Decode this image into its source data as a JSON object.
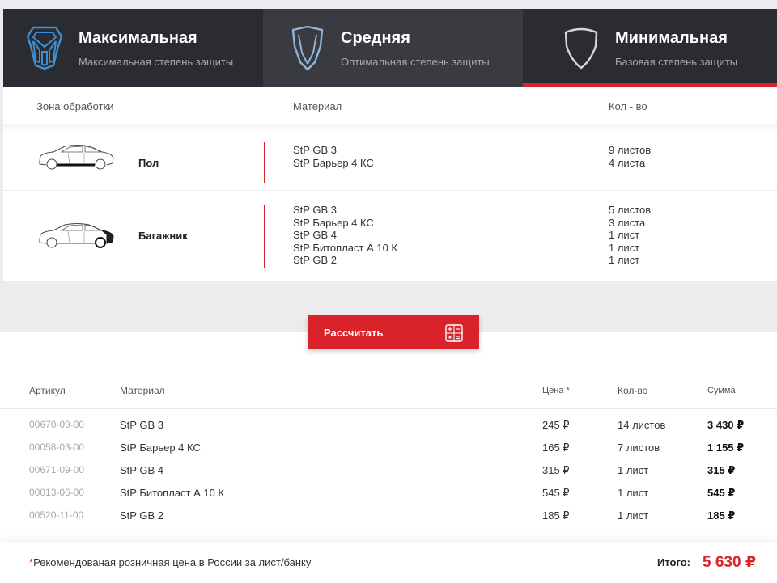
{
  "tabs": [
    {
      "title": "Максимальная",
      "subtitle": "Максимальная степень защиты"
    },
    {
      "title": "Средняя",
      "subtitle": "Оптимальная степень защиты"
    },
    {
      "title": "Минимальная",
      "subtitle": "Базовая степень защиты"
    }
  ],
  "colors": {
    "accent": "#d9222a",
    "tab_bg": "#2b2c31",
    "tab_active_bg": "#3a3b41",
    "icon_blue": "#3a8fd6"
  },
  "zone_table": {
    "headers": {
      "zone": "Зона обработки",
      "material": "Материал",
      "qty": "Кол - во"
    },
    "rows": [
      {
        "zone": "Пол",
        "materials": [
          "StP GB 3",
          "StP Барьер 4 КС"
        ],
        "quantities": [
          "9 листов",
          "4 листа"
        ]
      },
      {
        "zone": "Багажник",
        "materials": [
          "StP GB 3",
          "StP Барьер 4 КС",
          "StP GB 4",
          "StP Битопласт А 10 К",
          "StP GB 2"
        ],
        "quantities": [
          "5 листов",
          "3 листа",
          "1 лист",
          "1 лист",
          "1 лист"
        ]
      }
    ]
  },
  "calc_button": {
    "label": "Рассчитать"
  },
  "result_table": {
    "headers": {
      "article": "Артикул",
      "material": "Материал",
      "price": "Цена",
      "price_mark": "*",
      "qty": "Кол-во",
      "sum": "Сумма"
    },
    "rows": [
      {
        "article": "00670-09-00",
        "material": "StP GB 3",
        "price": "245 ₽",
        "qty": "14 листов",
        "sum": "3 430 ₽"
      },
      {
        "article": "00058-03-00",
        "material": "StP Барьер 4 КС",
        "price": "165 ₽",
        "qty": "7 листов",
        "sum": "1 155 ₽"
      },
      {
        "article": "00671-09-00",
        "material": "StP GB 4",
        "price": "315 ₽",
        "qty": "1 лист",
        "sum": "315 ₽"
      },
      {
        "article": "00013-06-00",
        "material": "StP Битопласт А 10 К",
        "price": "545 ₽",
        "qty": "1 лист",
        "sum": "545 ₽"
      },
      {
        "article": "00520-11-00",
        "material": "StP GB 2",
        "price": "185 ₽",
        "qty": "1 лист",
        "sum": "185 ₽"
      }
    ]
  },
  "footer": {
    "note_mark": "*",
    "note": "Рекомендованая розничная цена в России за лист/банку",
    "total_label": "Итого:",
    "total_value": "5 630 ₽"
  }
}
